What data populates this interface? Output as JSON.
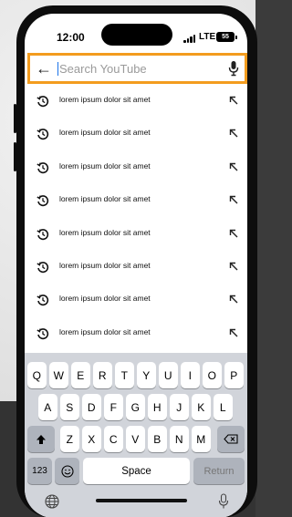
{
  "status_bar": {
    "time": "12:00",
    "network": "LTE",
    "battery": "55"
  },
  "search": {
    "placeholder": "Search YouTube",
    "value": "",
    "back_icon": "arrow-left-icon",
    "mic_icon": "microphone-icon",
    "highlight_color": "#f39c1e"
  },
  "suggestions": [
    {
      "text": "lorem ipsum dolor sit amet"
    },
    {
      "text": "lorem ipsum dolor sit amet"
    },
    {
      "text": "lorem ipsum dolor sit amet"
    },
    {
      "text": "lorem ipsum dolor sit amet"
    },
    {
      "text": "lorem ipsum dolor sit amet"
    },
    {
      "text": "lorem ipsum dolor sit amet"
    },
    {
      "text": "lorem ipsum dolor sit amet"
    },
    {
      "text": "lorem ipsum dolor sit amet"
    }
  ],
  "keyboard": {
    "row1": [
      "Q",
      "W",
      "E",
      "R",
      "T",
      "Y",
      "U",
      "I",
      "O",
      "P"
    ],
    "row2": [
      "A",
      "S",
      "D",
      "F",
      "G",
      "H",
      "J",
      "K",
      "L"
    ],
    "row3": [
      "Z",
      "X",
      "C",
      "V",
      "B",
      "N",
      "M"
    ],
    "numbers_label": "123",
    "space_label": "Space",
    "return_label": "Return",
    "shift_icon": "shift-arrow-icon",
    "delete_icon": "backspace-icon",
    "emoji_icon": "emoji-icon",
    "globe_icon": "globe-icon",
    "dictation_icon": "microphone-icon"
  }
}
